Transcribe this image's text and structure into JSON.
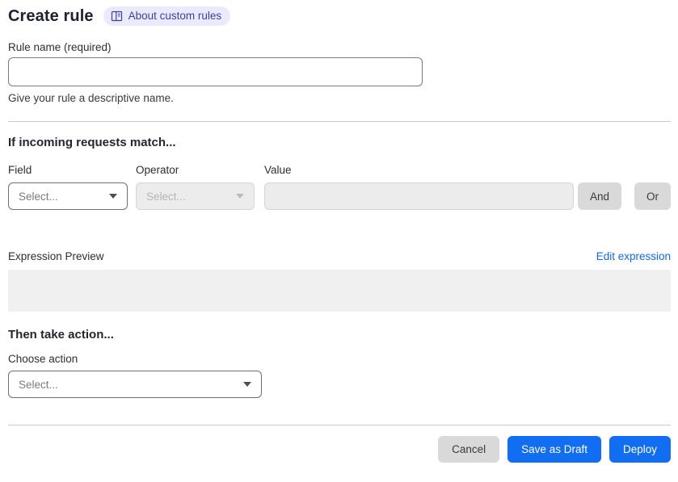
{
  "header": {
    "title": "Create rule",
    "about_badge": {
      "label": "About custom rules",
      "icon": "book-icon"
    }
  },
  "rule_name": {
    "label": "Rule name (required)",
    "value": "",
    "helper": "Give your rule a descriptive name."
  },
  "match_section": {
    "heading": "If incoming requests match...",
    "field": {
      "label": "Field",
      "selected": "Select...",
      "state": "enabled"
    },
    "operator": {
      "label": "Operator",
      "selected": "Select...",
      "state": "disabled"
    },
    "value": {
      "label": "Value",
      "value": "",
      "state": "disabled"
    },
    "and_button_label": "And",
    "or_button_label": "Or",
    "expression_preview_label": "Expression Preview",
    "edit_expression_link": "Edit expression",
    "expression_value": ""
  },
  "action_section": {
    "heading": "Then take action...",
    "choose_action_label": "Choose action",
    "action_select": {
      "selected": "Select...",
      "state": "enabled"
    }
  },
  "footer": {
    "cancel_label": "Cancel",
    "save_draft_label": "Save as Draft",
    "deploy_label": "Deploy"
  },
  "colors": {
    "accent_blue": "#116df2",
    "link_blue": "#0f6af0",
    "badge_bg": "#eaeafc",
    "badge_text": "#3e3fa4",
    "disabled_bg": "#ececec",
    "neutral_button_bg": "#d9d9d9",
    "preview_box_bg": "#f0f0f0",
    "divider": "#c9c9c9"
  }
}
